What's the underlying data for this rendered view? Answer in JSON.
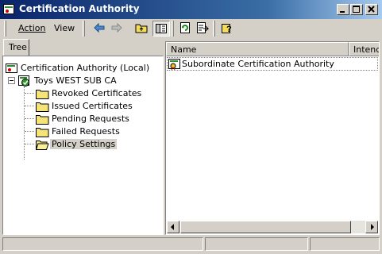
{
  "window": {
    "title": "Certification Authority"
  },
  "menu": {
    "action": "Action",
    "view": "View"
  },
  "tree_tab": {
    "label": "Tree"
  },
  "tree": {
    "root": "Certification Authority (Local)",
    "ca": "Toys WEST SUB CA",
    "folders": [
      "Revoked Certificates",
      "Issued Certificates",
      "Pending Requests",
      "Failed Requests",
      "Policy Settings"
    ],
    "selected": "Policy Settings"
  },
  "list": {
    "columns": [
      "Name",
      "Intend"
    ],
    "rows": [
      "Subordinate Certification Authority"
    ]
  },
  "icons": {
    "back": "back-arrow-icon",
    "forward": "forward-arrow-icon",
    "up": "up-folder-icon",
    "show_tree": "show-tree-icon",
    "refresh": "refresh-icon",
    "export": "export-list-icon",
    "help": "help-icon"
  }
}
